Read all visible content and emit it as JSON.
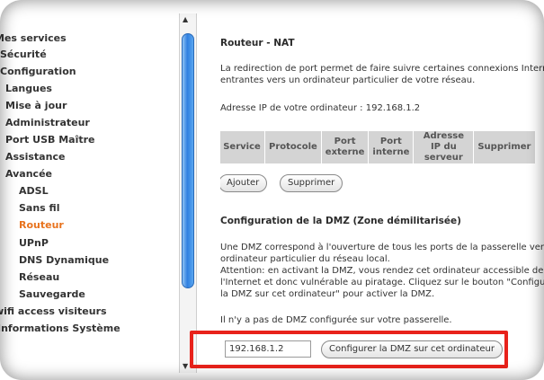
{
  "sidebar": {
    "items": [
      {
        "label": "Mes services",
        "level": 0
      },
      {
        "label": "Sécurité",
        "level": 0
      },
      {
        "label": "Configuration",
        "level": 0
      },
      {
        "label": "Langues",
        "level": 1
      },
      {
        "label": "Mise à jour",
        "level": 1
      },
      {
        "label": "Administrateur",
        "level": 1
      },
      {
        "label": "Port USB Maître",
        "level": 1
      },
      {
        "label": "Assistance",
        "level": 1
      },
      {
        "label": "Avancée",
        "level": 1
      },
      {
        "label": "ADSL",
        "level": 2
      },
      {
        "label": "Sans fil",
        "level": 2
      },
      {
        "label": "Routeur",
        "level": 2,
        "active": true
      },
      {
        "label": "UPnP",
        "level": 2
      },
      {
        "label": "DNS Dynamique",
        "level": 2
      },
      {
        "label": "Réseau",
        "level": 2
      },
      {
        "label": "Sauvegarde",
        "level": 2
      },
      {
        "label": "wifi access visiteurs",
        "level": 0
      },
      {
        "label": "Informations Système",
        "level": 0
      }
    ]
  },
  "nat": {
    "title": "Routeur - NAT",
    "desc_line1": "La redirection de port permet de faire suivre certaines connexions Internet",
    "desc_line2": "entrantes vers un ordinateur particulier de votre réseau.",
    "ip_line": "Adresse IP de votre ordinateur : 192.168.1.2",
    "table_headers": [
      "Service",
      "Protocole",
      "Port externe",
      "Port interne",
      "Adresse IP du serveur",
      "Supprimer"
    ],
    "add_button": "Ajouter",
    "delete_button": "Supprimer"
  },
  "dmz": {
    "title": "Configuration de la DMZ (Zone démilitarisée)",
    "desc_lines": [
      "Une DMZ correspond à l'ouverture de tous les ports de la passerelle vers un",
      "ordinateur particulier du réseau local.",
      "Attention: en activant la DMZ, vous rendez cet ordinateur accessible depuis",
      "l'Internet et donc vulnérable au piratage. Cliquez sur le bouton \"Configurer",
      "la DMZ sur cet ordinateur\" pour activer la DMZ."
    ],
    "status": "Il n'y a pas de DMZ configurée sur votre passerelle.",
    "ip_value": "192.168.1.2",
    "configure_button": "Configurer la DMZ sur cet ordinateur"
  },
  "colors": {
    "active_nav": "#e8731e",
    "highlight": "#e8221b",
    "scroll_thumb": "#2f7fe0",
    "table_header_bg": "#d4d4d4"
  },
  "icons": {
    "scroll_up": "scroll-up-arrow-icon",
    "scroll_down": "scroll-down-arrow-icon"
  }
}
